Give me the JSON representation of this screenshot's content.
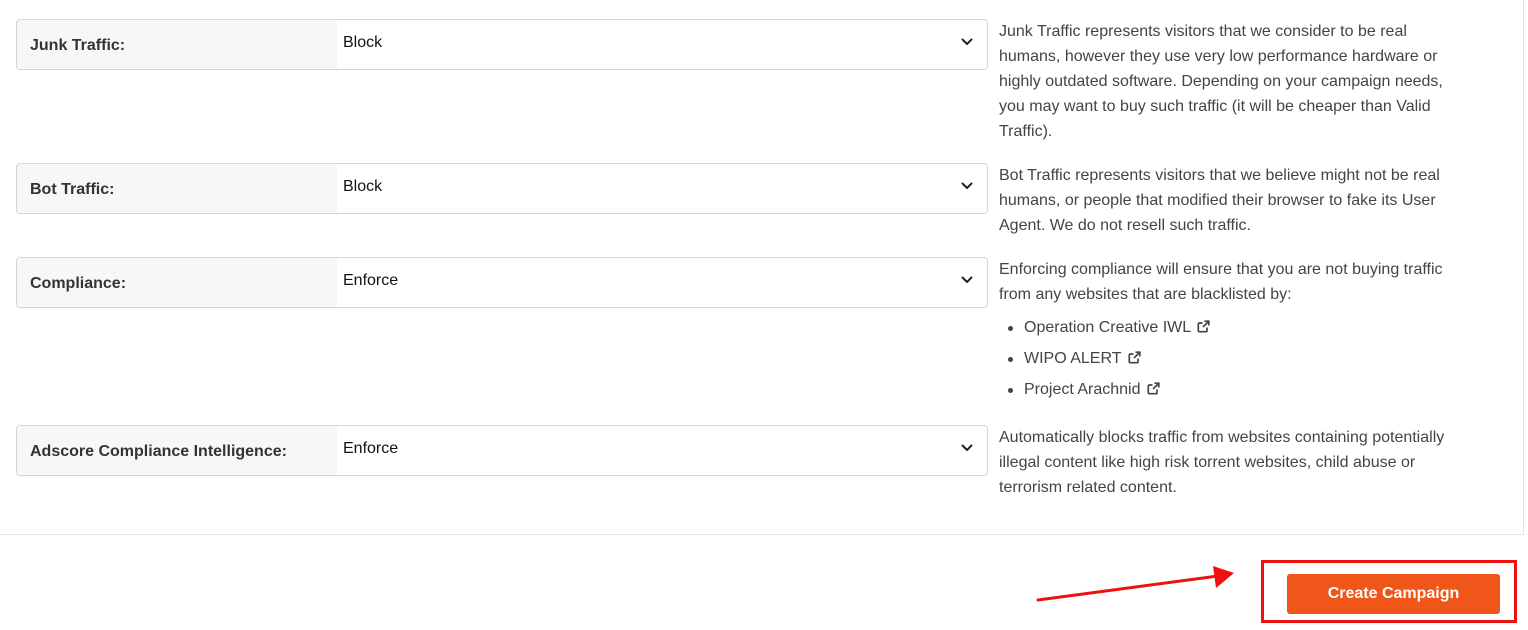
{
  "settings": [
    {
      "label": "Junk Traffic:",
      "value": "Block",
      "description": "Junk Traffic represents visitors that we consider to be real humans, however they use very low performance hardware or highly outdated software. Depending on your campaign needs, you may want to buy such traffic (it will be cheaper than Valid Traffic)."
    },
    {
      "label": "Bot Traffic:",
      "value": "Block",
      "description": "Bot Traffic represents visitors that we believe might not be real humans, or people that modified their browser to fake its User Agent. We do not resell such traffic."
    },
    {
      "label": "Compliance:",
      "value": "Enforce",
      "description": "Enforcing compliance will ensure that you are not buying traffic from any websites that are blacklisted by:",
      "links": [
        "Operation Creative IWL",
        "WIPO ALERT",
        "Project Arachnid"
      ]
    },
    {
      "label": "Adscore Compliance Intelligence:",
      "value": "Enforce",
      "description": "Automatically blocks traffic from websites containing potentially illegal content like high risk torrent websites, child abuse or terrorism related content."
    }
  ],
  "footer": {
    "create_label": "Create Campaign"
  },
  "icons": {
    "select_arrow": "chevron-down-icon",
    "external_link": "external-link-icon"
  },
  "colors": {
    "primary_button": "#f0561a",
    "highlight": "#ee1111"
  }
}
